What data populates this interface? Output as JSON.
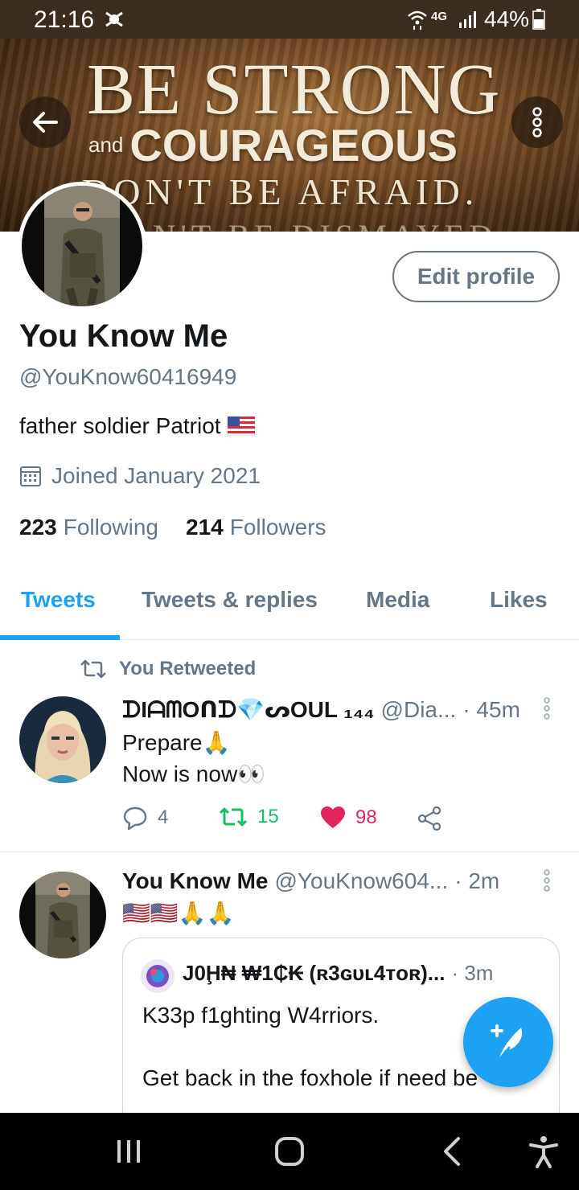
{
  "status_bar": {
    "time": "21:16",
    "network": "4G",
    "battery": "44%",
    "icons": [
      "notification-icon",
      "wifi-icon",
      "signal-icon",
      "battery-icon"
    ]
  },
  "banner": {
    "line1": "BE STRONG",
    "line2_small": "and",
    "line2_big": "COURAGEOUS",
    "line3": "DON'T BE AFRAID.",
    "line4": "DON'T BE DISMAYED"
  },
  "profile": {
    "edit_label": "Edit profile",
    "display_name": "You Know Me",
    "handle": "@YouKnow60416949",
    "bio": "father soldier Patriot",
    "bio_emoji": "us-flag",
    "joined": "Joined January 2021",
    "following_count": "223",
    "following_label": "Following",
    "followers_count": "214",
    "followers_label": "Followers"
  },
  "tabs": [
    {
      "label": "Tweets",
      "active": true
    },
    {
      "label": "Tweets & replies",
      "active": false
    },
    {
      "label": "Media",
      "active": false
    },
    {
      "label": "Likes",
      "active": false
    }
  ],
  "tweets": [
    {
      "retweet_label": "You Retweeted",
      "author": "ᗪIᗩᗰOᑎᗪ💎ᔕOUL ₁₄₄",
      "handle": "@Dia...",
      "time": "· 45m",
      "line1": "Prepare🙏",
      "line2": "Now is now👀",
      "replies": "4",
      "retweets": "15",
      "likes": "98"
    },
    {
      "author": "You Know Me",
      "handle": "@YouKnow604...",
      "time": "· 2m",
      "text": "🇺🇸🇺🇸🙏🙏",
      "quote": {
        "author": "J0Ḩ₦ ₩1₵₭ (ʀ3ɢᴜʟ4ᴛᴏʀ)...",
        "time": "· 3m",
        "line1": "K33p f1ghting W4rriors.",
        "line2": "Get back in the foxhole if need be"
      }
    }
  ],
  "colors": {
    "accent": "#1da1f2",
    "secondary_text": "#657786",
    "retweet_green": "#17bf63",
    "like_red": "#e0245e"
  }
}
